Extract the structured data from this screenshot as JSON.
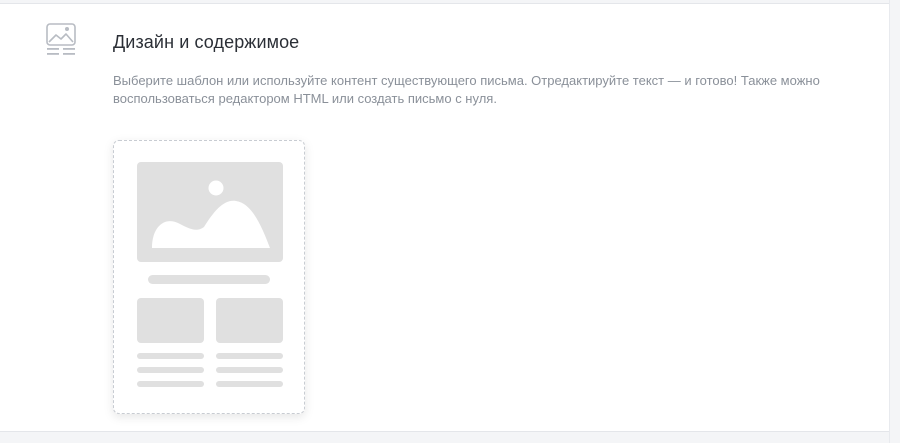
{
  "section": {
    "icon": "email-design-icon",
    "title": "Дизайн и содержимое",
    "description": "Выберите шаблон или используйте контент существующего письма. Отредактируйте текст — и готово! Также можно воспользоваться редактором HTML или создать письмо с нуля."
  },
  "template_placeholder": {
    "icons": [
      "image-placeholder-icon",
      "mountain-icon",
      "sun-icon"
    ]
  },
  "colors": {
    "placeholder_fill": "#e0e0e0",
    "icon_stroke": "#b8bcc3",
    "title_text": "#2b2f36",
    "description_text": "#8a9099"
  }
}
